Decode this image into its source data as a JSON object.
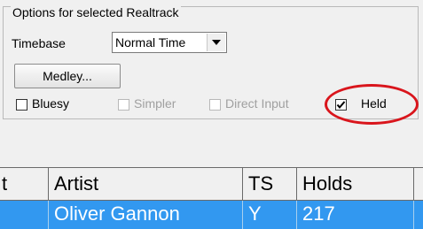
{
  "group": {
    "title": "Options for selected Realtrack"
  },
  "timebase": {
    "label": "Timebase",
    "selected": "Normal Time",
    "dropdown_icon": "triangle-down-icon"
  },
  "medley_button": "Medley...",
  "checkboxes": [
    {
      "label": "Bluesy",
      "checked": false,
      "enabled": true
    },
    {
      "label": "Simpler",
      "checked": false,
      "enabled": false
    },
    {
      "label": "Direct Input",
      "checked": false,
      "enabled": false
    },
    {
      "label": "Held",
      "checked": true,
      "enabled": true
    }
  ],
  "highlight_color": "#d9151c",
  "selection_color": "#3298f0",
  "table": {
    "headers": [
      "t",
      "Artist",
      "TS",
      "Holds",
      ""
    ],
    "rows": [
      [
        "",
        "Oliver Gannon",
        "Y",
        "217",
        ""
      ]
    ]
  }
}
